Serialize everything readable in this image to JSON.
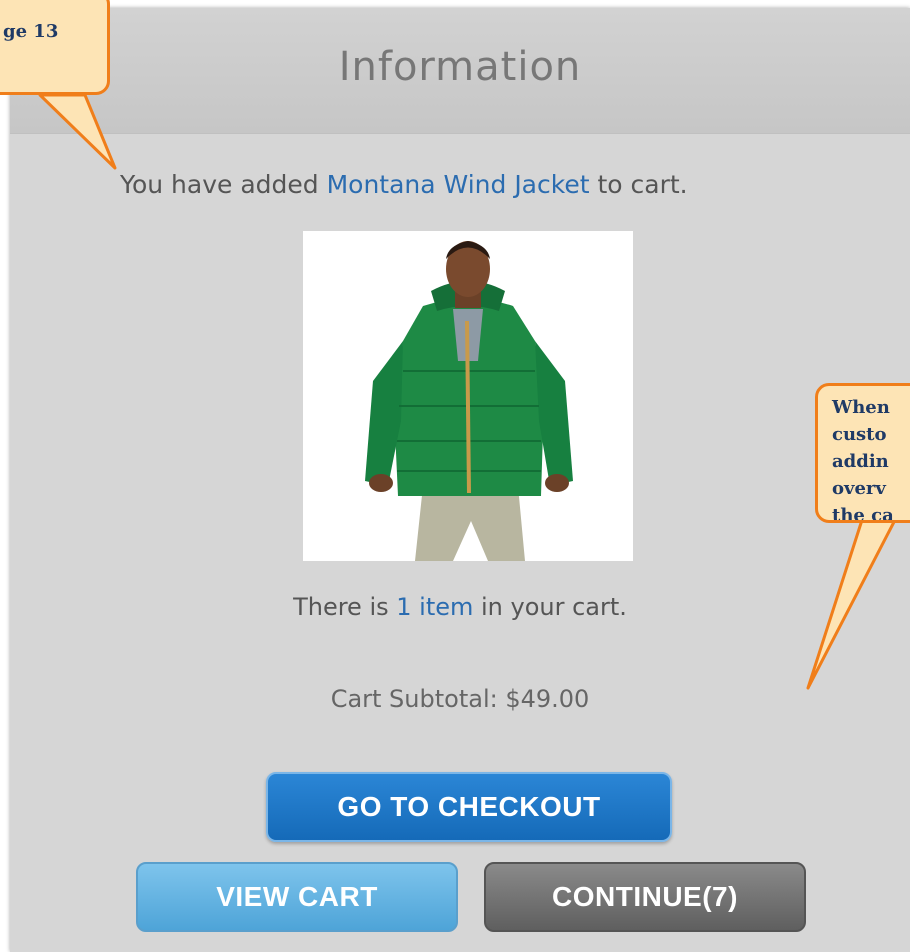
{
  "dialog": {
    "title": "Information",
    "added_prefix": "You have added ",
    "product_name": "Montana Wind Jacket",
    "added_suffix": " to cart.",
    "cart_count_prefix": "There is ",
    "cart_count_link": "1 item",
    "cart_count_suffix": " in your cart.",
    "subtotal_text": "Cart Subtotal: $49.00"
  },
  "buttons": {
    "checkout": "GO TO CHECKOUT",
    "view_cart": "VIEW CART",
    "continue": "CONTINUE(7)"
  },
  "callouts": {
    "left": "ge 13",
    "right_lines": [
      "When",
      "custo",
      "addin",
      "overv",
      "the ca"
    ]
  },
  "colors": {
    "accent_blue": "#1a6fbf",
    "callout_border": "#f07e1a",
    "callout_fill": "#fde4b5",
    "link": "#2b6cb0"
  }
}
